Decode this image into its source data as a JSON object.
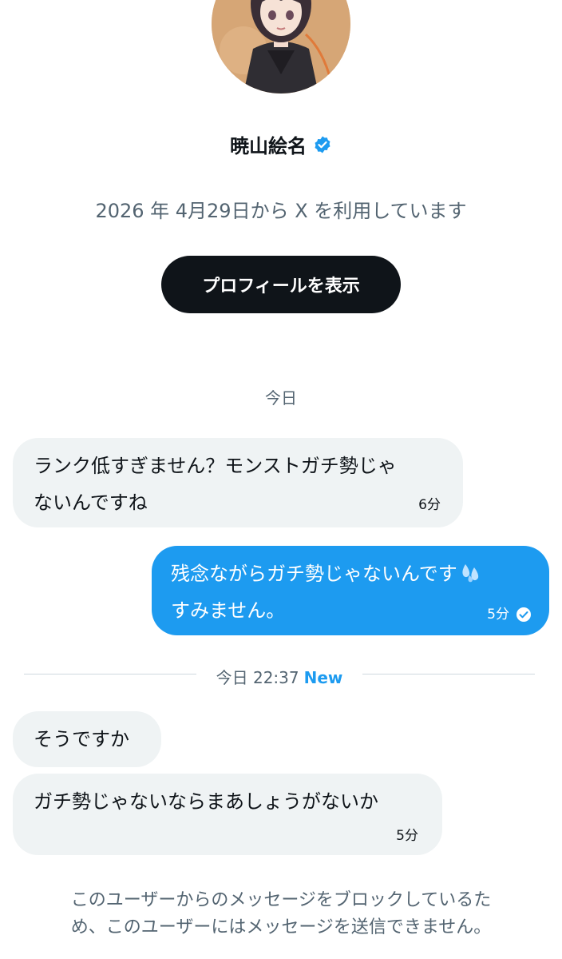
{
  "profile": {
    "name": "暁山絵名",
    "joined": "2026 年 4月29日から X を利用しています",
    "view_profile_label": "プロフィールを表示"
  },
  "date_separator": "今日",
  "messages": [
    {
      "direction": "received",
      "lines": [
        "ランク低すぎません？モンストガチ勢じゃ",
        "ないんですね"
      ],
      "time": "6分"
    },
    {
      "direction": "sent",
      "lines": [
        "残念ながらガチ勢じゃないんです",
        "すみません。"
      ],
      "emoji": "sweat-droplets-icon",
      "time": "5分",
      "status": "read"
    },
    {
      "direction": "received",
      "lines": [
        "そうですか"
      ],
      "time": ""
    },
    {
      "direction": "received",
      "lines": [
        "ガチ勢じゃないならまあしょうがないか"
      ],
      "time": "5分"
    }
  ],
  "new_divider": {
    "label": "今日 22:37",
    "badge": "New"
  },
  "blocked_notice": {
    "lines": [
      "このユーザーからのメッセージをブロックしているた",
      "め、このユーザーにはメッセージを送信できません。"
    ]
  },
  "colors": {
    "accent": "#1d9bf0",
    "button_bg": "#0f1419",
    "received_bubble": "#eff3f4",
    "muted_text": "#536471"
  }
}
